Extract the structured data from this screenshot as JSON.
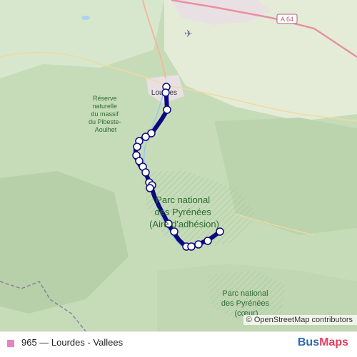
{
  "map": {
    "labels": {
      "airport_road": "A 64",
      "town": "Lourdes",
      "reserve": [
        "Réserve",
        "naturelle",
        "du massif",
        "du Pibeste-",
        "Aoulhet"
      ],
      "park_adhesion": [
        "Parc national",
        "des Pyrénées",
        "(Aire d'adhésion)"
      ],
      "park_core": [
        "Parc national",
        "des Pyrénées",
        "(cœur)"
      ]
    },
    "attribution": "© OpenStreetMap contributors",
    "colors": {
      "route": "#0d0a7e",
      "stop_fill": "#ffffff",
      "terrain": "#cfe3c4",
      "urban": "#e9e0e3"
    }
  },
  "legend": {
    "route_label": "965 — Lourdes - Vallees",
    "route_color": "#e586c0"
  },
  "brand": {
    "part1": "Bus",
    "part2": "Maps"
  }
}
